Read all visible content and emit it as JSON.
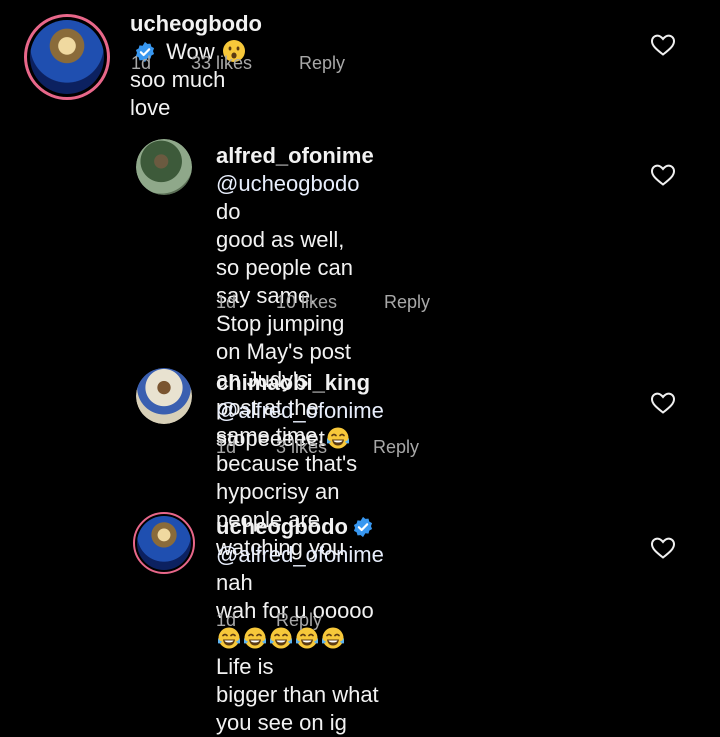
{
  "comments": [
    {
      "username": "ucheogbodo",
      "verified": true,
      "text_before": "Wow",
      "emoji": "astonished-face",
      "text_after": "soo much love",
      "time": "1d",
      "likes": "33 likes",
      "reply": "Reply"
    },
    {
      "username": "alfred_ofonime",
      "mention": "@ucheogbodo",
      "line1_rest": " do",
      "lines": [
        "good as well, so people can say same.",
        "Stop jumping on May's post an Judy's",
        "post at the same time, because that's",
        "hypocrisy an people are watching you"
      ],
      "time": "1d",
      "likes": "10 likes",
      "reply": "Reply"
    },
    {
      "username": "chimaobi_king",
      "mention": "@alfred_ofonime",
      "line2": "stopeeeeet",
      "emoji": "tears-of-joy",
      "time": "1d",
      "likes": "3 likes",
      "reply": "Reply"
    },
    {
      "username": "ucheogbodo",
      "verified": true,
      "mention": "@alfred_ofonime",
      "line1_rest": " nah",
      "line2_before": "wah for u ooooo",
      "emojis": [
        "tears-of-joy",
        "tears-of-joy",
        "tears-of-joy",
        "tears-of-joy",
        "tears-of-joy"
      ],
      "line2_after": " Life is",
      "line3": "bigger than what you see on ig",
      "time": "1d",
      "reply": "Reply"
    }
  ],
  "colors": {
    "background": "#000000",
    "text": "#f2f2f2",
    "meta": "#a8a8a8",
    "verified": "#3897f0",
    "story_ring": "#e8678a"
  }
}
